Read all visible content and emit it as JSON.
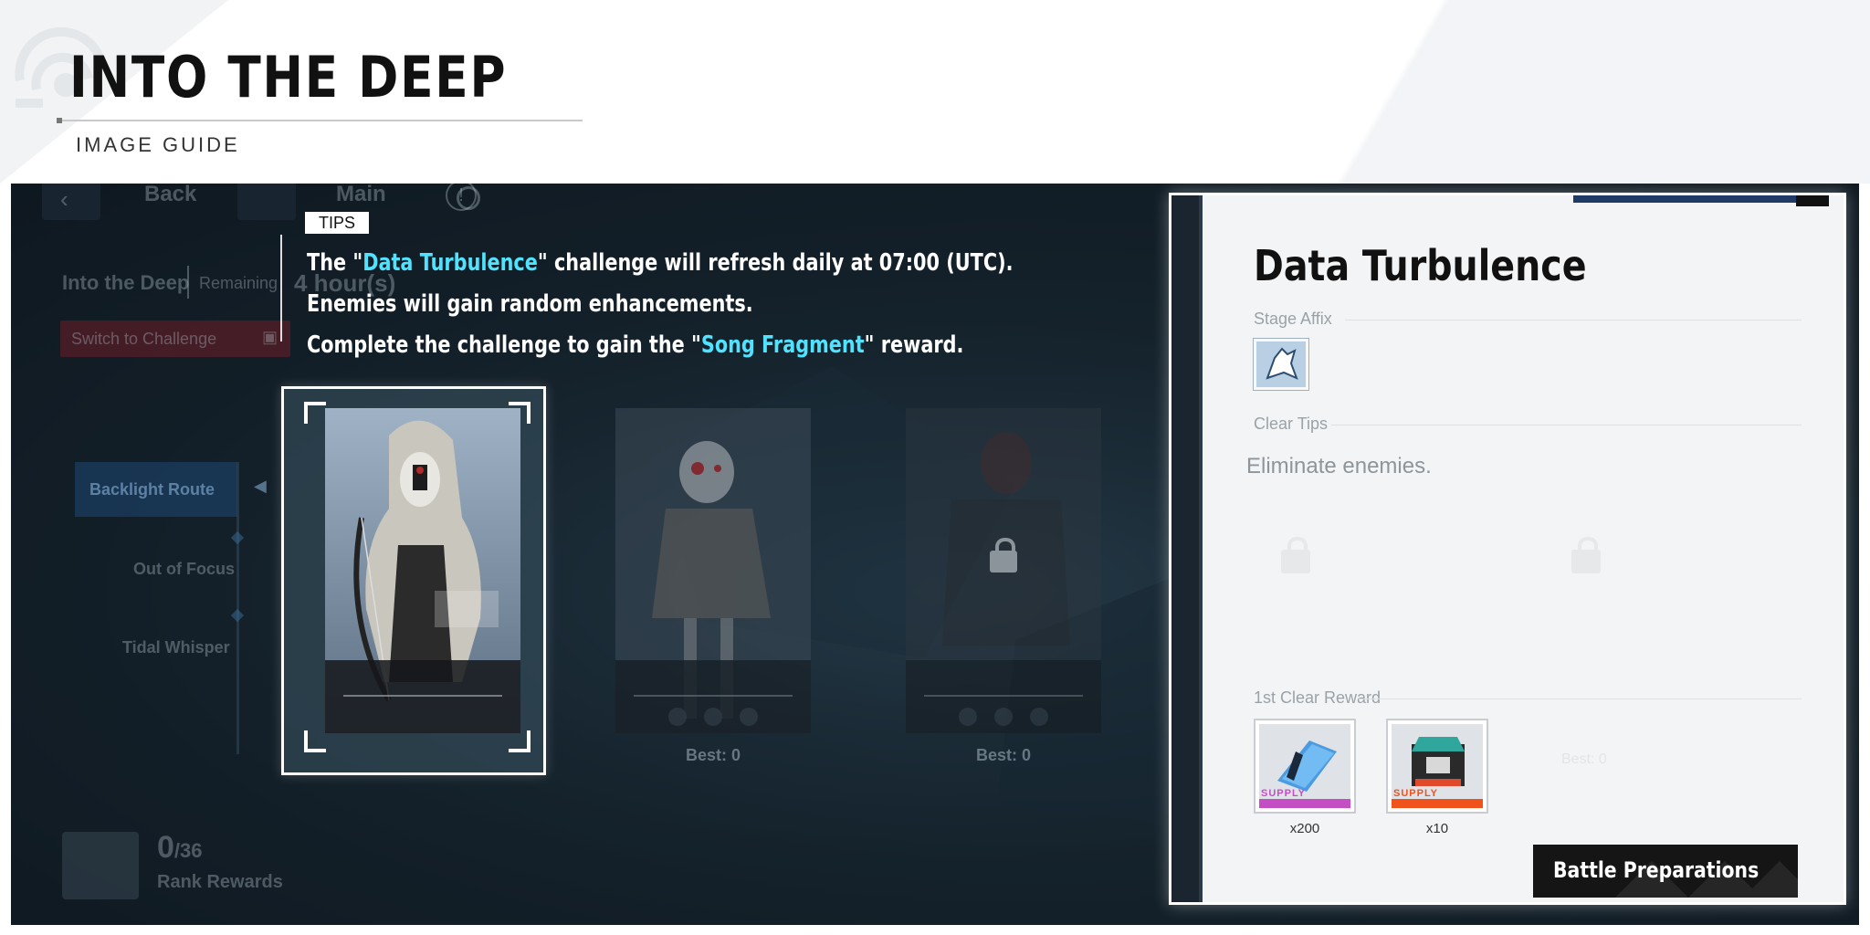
{
  "header": {
    "title": "INTO THE DEEP",
    "subtitle": "IMAGE GUIDE"
  },
  "nav": {
    "back_label": "Back",
    "main_label": "Main",
    "info_glyph": "!"
  },
  "mode": {
    "name": "Into the Deep",
    "remaining_label": "Remaining",
    "remaining_value": "4 hour(s)",
    "switch_label": "Switch to Challenge"
  },
  "routes": [
    {
      "label": "Backlight Route",
      "selected": true
    },
    {
      "label": "Out of Focus",
      "selected": false
    },
    {
      "label": "Tidal Whisper",
      "selected": false
    }
  ],
  "tips": {
    "tag": "TIPS",
    "line1": {
      "pre": "The \"",
      "hl": "Data Turbulence",
      "post": "\" challenge will refresh daily at 07:00 (UTC)."
    },
    "line2": "Enemies will gain random enhancements.",
    "line3": {
      "pre": "Complete the challenge to gain the \"",
      "hl": "Song Fragment",
      "post": "\" reward."
    }
  },
  "cards": [
    {
      "name": "Hooded Archer",
      "best": "",
      "locked": false
    },
    {
      "name": "Red-eyed Construct",
      "best": "Best: 0",
      "locked": false
    },
    {
      "name": "Helmeted Soldier",
      "best": "Best: 0",
      "locked": true
    }
  ],
  "panel": {
    "stage_name": "Data Turbulence",
    "affix_label": "Stage Affix",
    "affix_icon": "wolf-emblem-icon",
    "clear_tips_label": "Clear Tips",
    "clear_tips_text": "Eliminate enemies.",
    "reward_label": "1st Clear Reward",
    "ghost_best": "Best: 0",
    "rewards": [
      {
        "name": "Supply Data Chip",
        "supply": "SUPPLY",
        "qty": "x200",
        "accent": "#c44fc4"
      },
      {
        "name": "Supply Processor",
        "supply": "SUPPLY",
        "qty": "x10",
        "accent": "#f0521c"
      }
    ],
    "battle_label": "Battle Preparations"
  },
  "rank": {
    "value": "0",
    "total": "/36",
    "label": "Rank Rewards"
  },
  "colors": {
    "highlight": "#4fe3ff",
    "panel_bg": "#f3f4f5",
    "battle_btn": "#151515"
  }
}
